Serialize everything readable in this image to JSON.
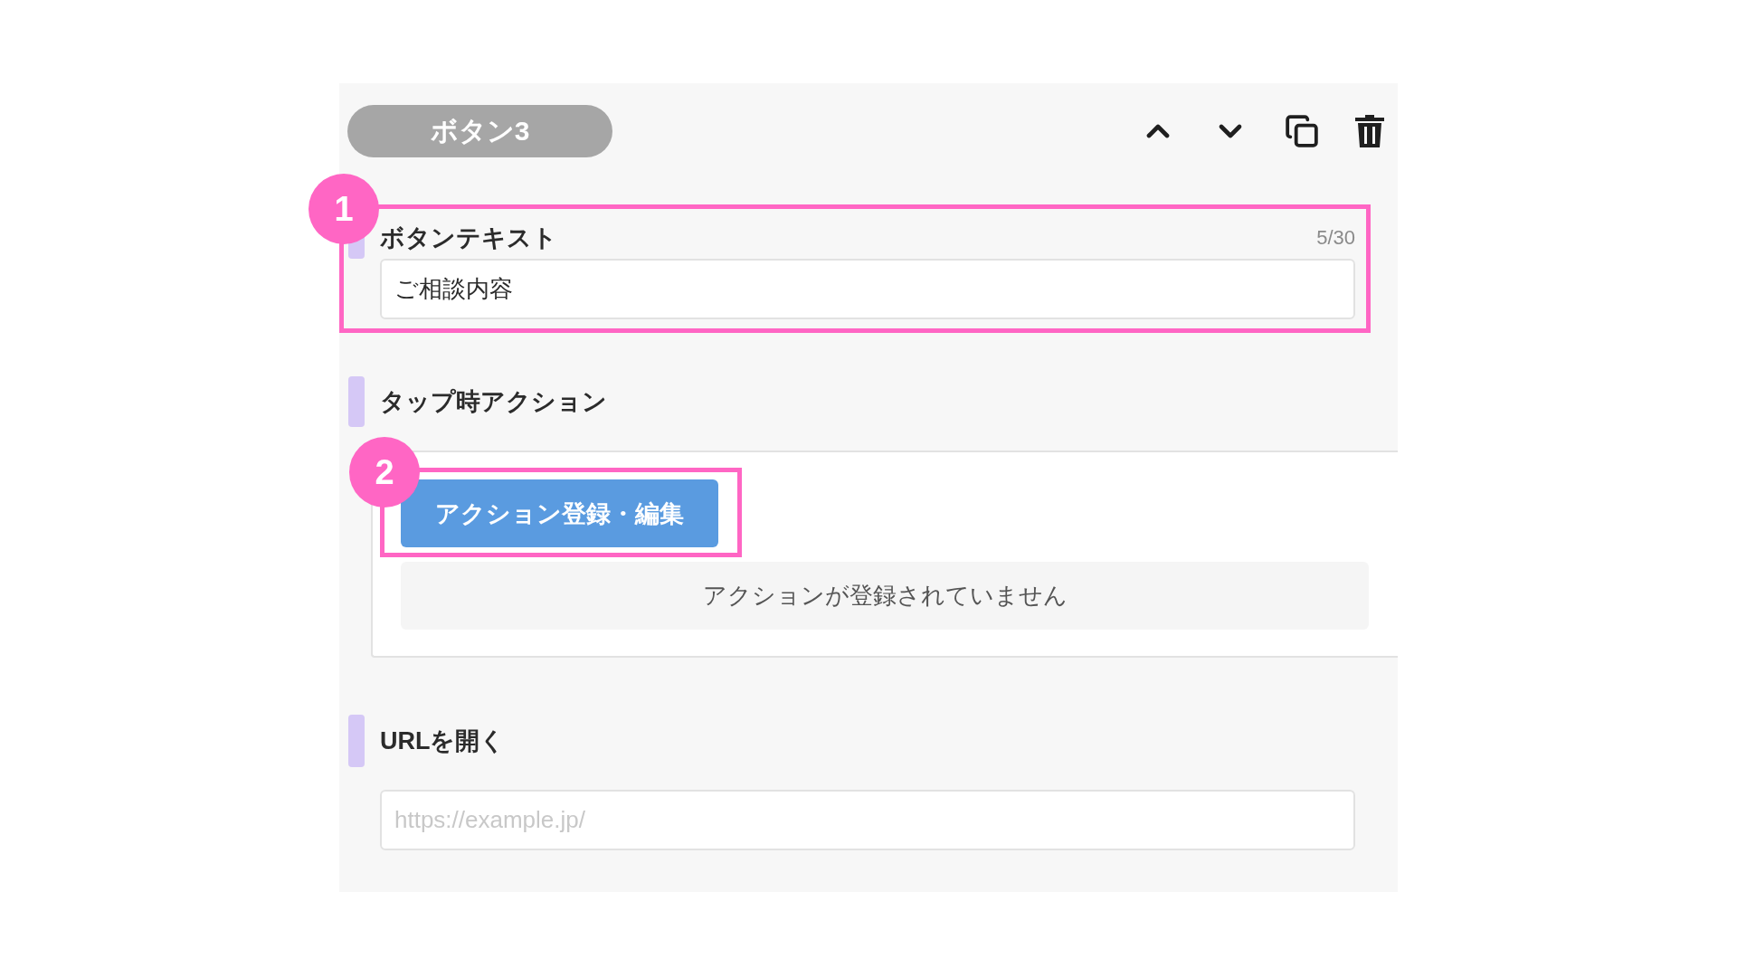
{
  "card": {
    "title": "ボタン3"
  },
  "button_text": {
    "label": "ボタンテキスト",
    "counter": "5/30",
    "value": "ご相談内容",
    "callout": "1"
  },
  "tap_action": {
    "label": "タップ時アクション",
    "button": "アクション登録・編集",
    "empty_message": "アクションが登録されていません",
    "callout": "2"
  },
  "open_url": {
    "label": "URLを開く",
    "placeholder": "https://example.jp/"
  }
}
